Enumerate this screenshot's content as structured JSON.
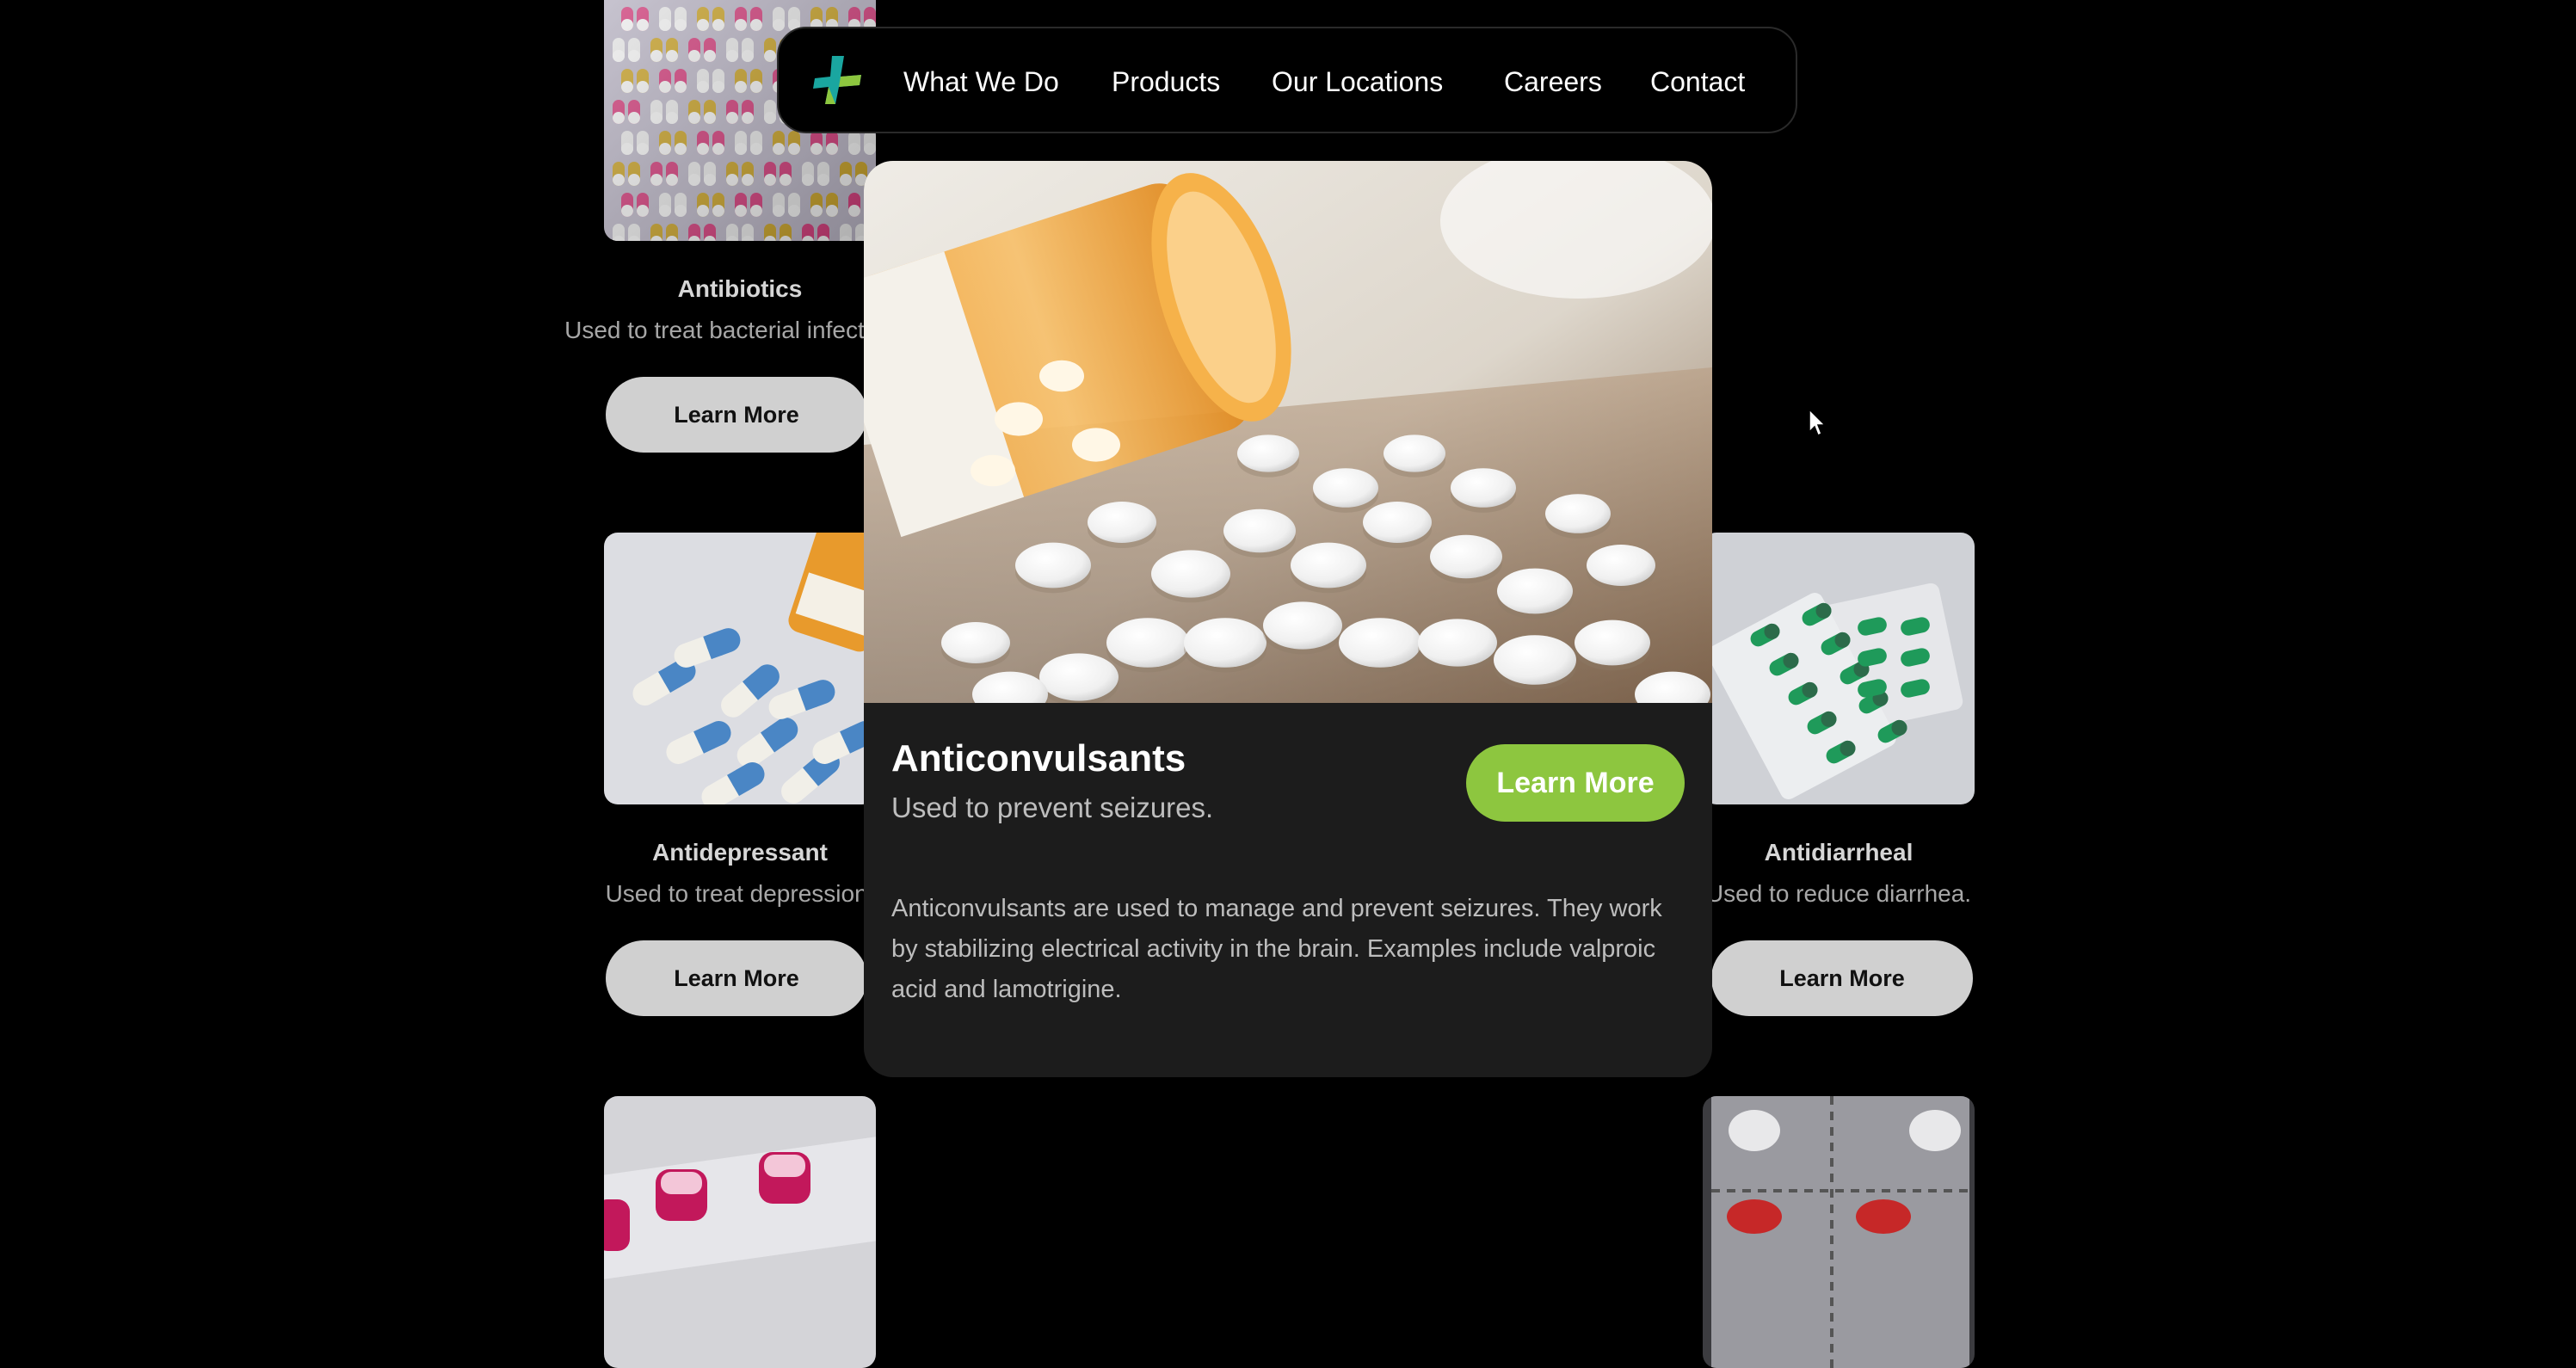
{
  "nav": {
    "items": [
      "What We Do",
      "Products",
      "Our Locations",
      "Careers",
      "Contact"
    ],
    "logo_icon": "medical-cross-icon",
    "brand_colors": [
      "#1aa6a0",
      "#8dc63f"
    ]
  },
  "cards": [
    {
      "title": "Antibiotics",
      "description": "Used to treat bacterial infections.",
      "button": "Learn More",
      "image": "colorful-capsule-blister-pack"
    },
    {
      "title": "Antidepressant",
      "description": "Used to treat depression.",
      "button": "Learn More",
      "image": "blue-white-capsules-with-bottle"
    },
    {
      "title": "Antidiarrheal",
      "description": "Used to reduce diarrhea.",
      "button": "Learn More",
      "image": "green-capsule-blister-pack"
    },
    {
      "image": "pink-pill-blister"
    },
    {
      "image": "red-white-pill-blister"
    }
  ],
  "modal": {
    "title": "Anticonvulsants",
    "subtitle": "Used to prevent seizures.",
    "button": "Learn More",
    "body": "Anticonvulsants are used to manage and prevent seizures. They work by stabilizing electrical activity in the brain. Examples include valproic acid and lamotrigine.",
    "image": "spilled-pill-bottle",
    "accent_color": "#8dc63f"
  }
}
